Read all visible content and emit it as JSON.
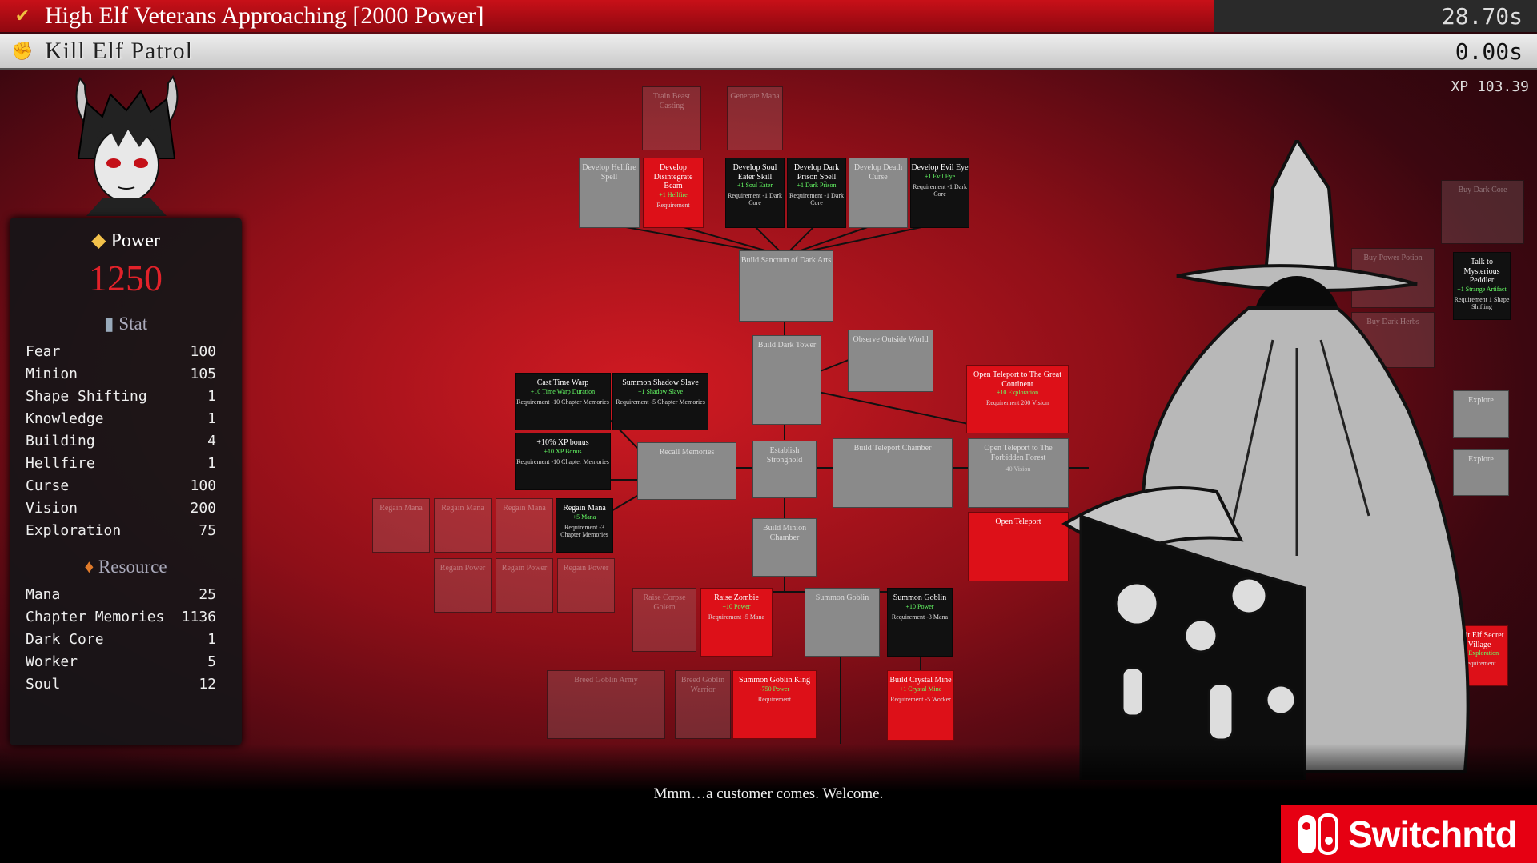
{
  "quests": [
    {
      "title": "High Elf Veterans Approaching [2000 Power]",
      "time": "28.70s",
      "progress": 0.79
    },
    {
      "title": "Kill Elf Patrol",
      "time": "0.00s",
      "progress": 1.0
    }
  ],
  "xp": "XP 103.39",
  "power": {
    "label": "Power",
    "value": "1250"
  },
  "stat": {
    "label": "Stat",
    "rows": [
      {
        "name": "Fear",
        "value": "100"
      },
      {
        "name": "Minion",
        "value": "105"
      },
      {
        "name": "Shape Shifting",
        "value": "1"
      },
      {
        "name": "Knowledge",
        "value": "1"
      },
      {
        "name": "Building",
        "value": "4"
      },
      {
        "name": "Hellfire",
        "value": "1"
      },
      {
        "name": "Curse",
        "value": "100"
      },
      {
        "name": "Vision",
        "value": "200"
      },
      {
        "name": "Exploration",
        "value": "75"
      }
    ]
  },
  "resource": {
    "label": "Resource",
    "rows": [
      {
        "name": "Mana",
        "value": "25"
      },
      {
        "name": "Chapter Memories",
        "value": "1136"
      },
      {
        "name": "Dark Core",
        "value": "1"
      },
      {
        "name": "Worker",
        "value": "5"
      },
      {
        "name": "Soul",
        "value": "12"
      }
    ]
  },
  "tree": {
    "nodes": [
      {
        "title": "Train Beast Casting",
        "style": "faded"
      },
      {
        "title": "Generate Mana",
        "style": "faded"
      },
      {
        "title": "Develop Hellfire Spell",
        "style": "gray"
      },
      {
        "title": "Develop Disintegrate Beam",
        "style": "red",
        "gain": "+1 Hellfire",
        "req": "Requirement"
      },
      {
        "title": "Develop Soul Eater Skill",
        "style": "black",
        "gain": "+1 Soul Eater",
        "req": "Requirement -1 Dark Core"
      },
      {
        "title": "Develop Dark Prison Spell",
        "style": "black",
        "gain": "+1 Dark Prison",
        "req": "Requirement -1 Dark Core"
      },
      {
        "title": "Develop Death Curse",
        "style": "gray"
      },
      {
        "title": "Develop Evil Eye",
        "style": "black",
        "gain": "+1 Evil Eye",
        "req": "Requirement -1 Dark Core"
      },
      {
        "title": "Build Sanctum of Dark Arts",
        "style": "gray"
      },
      {
        "title": "Build Dark Tower",
        "style": "gray"
      },
      {
        "title": "Observe Outside World",
        "style": "gray"
      },
      {
        "title": "Open Teleport to The Great Continent",
        "style": "red",
        "gain": "+10 Exploration",
        "req": "Requirement 200 Vision"
      },
      {
        "title": "Cast Time Warp",
        "style": "black",
        "gain": "+10 Time Warp Duration",
        "req": "Requirement -10 Chapter Memories"
      },
      {
        "title": "Summon Shadow Slave",
        "style": "black",
        "gain": "+1 Shadow Slave",
        "req": "Requirement -5 Chapter Memories"
      },
      {
        "title": "+10% XP bonus",
        "style": "black",
        "gain": "+10 XP Bonus",
        "req": "Requirement -10 Chapter Memories"
      },
      {
        "title": "Recall Memories",
        "style": "gray"
      },
      {
        "title": "Establish Stronghold",
        "style": "gray"
      },
      {
        "title": "Build Teleport Chamber",
        "style": "gray"
      },
      {
        "title": "Open Teleport to The Forbidden Forest",
        "style": "gray",
        "req": "40 Vision"
      },
      {
        "title": "Open Teleport",
        "style": "red"
      },
      {
        "title": "Regain Mana",
        "style": "faded"
      },
      {
        "title": "Regain Mana",
        "style": "faded"
      },
      {
        "title": "Regain Mana",
        "style": "faded"
      },
      {
        "title": "Regain Mana",
        "style": "black",
        "gain": "+5 Mana",
        "req": "Requirement -3 Chapter Memories"
      },
      {
        "title": "Regain Power",
        "style": "faded"
      },
      {
        "title": "Regain Power",
        "style": "faded"
      },
      {
        "title": "Regain Power",
        "style": "faded"
      },
      {
        "title": "Build Minion Chamber",
        "style": "gray"
      },
      {
        "title": "Raise Corpse Golem",
        "style": "faded"
      },
      {
        "title": "Raise Zombie",
        "style": "red",
        "gain": "+10 Power",
        "req": "Requirement -5 Mana"
      },
      {
        "title": "Summon Goblin",
        "style": "gray"
      },
      {
        "title": "Summon Goblin",
        "style": "black",
        "gain": "+10 Power",
        "req": "Requirement -3 Mana"
      },
      {
        "title": "Breed Goblin Army",
        "style": "faded"
      },
      {
        "title": "Breed Goblin Warrior",
        "style": "faded"
      },
      {
        "title": "Summon Goblin King",
        "style": "red",
        "gain": "-750 Power",
        "req": "Requirement"
      },
      {
        "title": "Build Crystal Mine",
        "style": "red",
        "gain": "+1 Crystal Mine",
        "req": "Requirement -5 Worker"
      },
      {
        "title": "Buy Dark Core",
        "style": "faded"
      },
      {
        "title": "Buy Power Potion",
        "style": "faded"
      },
      {
        "title": "Talk to Mysterious Peddler",
        "style": "black",
        "gain": "+1 Strange Artifact",
        "req": "Requirement 1 Shape Shifting"
      },
      {
        "title": "Buy Dark Herbs",
        "style": "faded"
      },
      {
        "title": "Explore",
        "style": "gray"
      },
      {
        "title": "Explore",
        "style": "gray"
      },
      {
        "title": "Visit Elf Secret Village",
        "style": "red",
        "gain": "+1 Exploration",
        "req": "Requirement"
      }
    ]
  },
  "dialogue": "Mmm…a customer comes. Welcome.",
  "watermark": "Switchntd",
  "colors": {
    "accent_red": "#dd1018",
    "power_red": "#e2222a",
    "panel": "#161618"
  }
}
